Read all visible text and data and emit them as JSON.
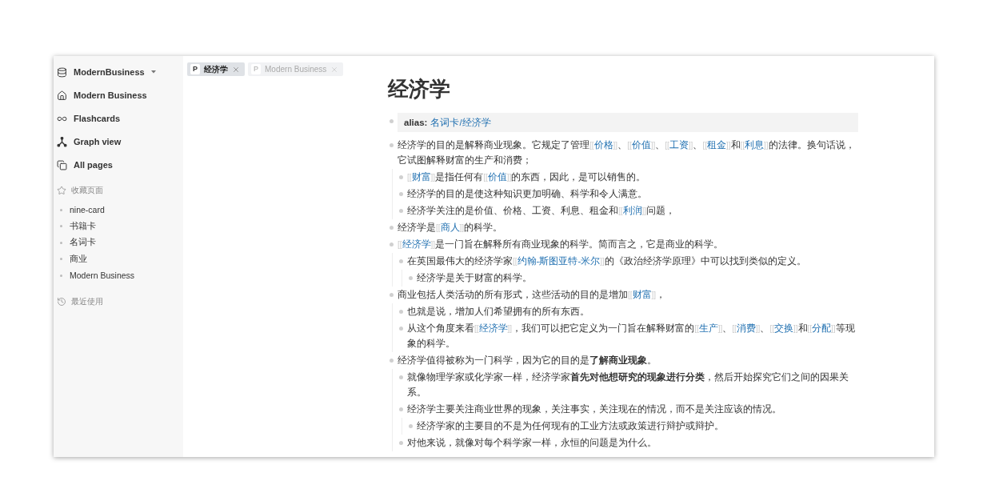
{
  "sidebar": {
    "workspace": "ModernBusiness",
    "nav": [
      {
        "kind": "home",
        "label": "Modern Business"
      },
      {
        "kind": "flashcards",
        "label": "Flashcards"
      },
      {
        "kind": "graph",
        "label": "Graph view"
      },
      {
        "kind": "pages",
        "label": "All pages"
      }
    ],
    "favorites": {
      "title": "收藏页面",
      "items": [
        "nine-card",
        "书籍卡",
        "名词卡",
        "商业",
        "Modern Business"
      ]
    },
    "recent": {
      "title": "最近使用"
    }
  },
  "tabs": [
    {
      "badge": "P",
      "label": "经济学",
      "selected": true
    },
    {
      "badge": "P",
      "label": "Modern Business",
      "selected": false
    }
  ],
  "page": {
    "title": "经济学",
    "blocks": [
      {
        "kind": "property",
        "label": "alias:",
        "value": "名词卡/经济学"
      },
      {
        "kind": "text",
        "segments": [
          {
            "kind": "text",
            "text": "经济学的目的是解释商业现象。它规定了管理"
          },
          {
            "kind": "link",
            "open": "[[",
            "text": "价格",
            "close": "]]"
          },
          {
            "kind": "text",
            "text": "、"
          },
          {
            "kind": "link",
            "open": "[[",
            "text": "价值",
            "close": "]]"
          },
          {
            "kind": "text",
            "text": "、"
          },
          {
            "kind": "link",
            "open": "[[",
            "text": "工资",
            "close": "]]"
          },
          {
            "kind": "text",
            "text": "、"
          },
          {
            "kind": "link",
            "open": "[[",
            "text": "租金",
            "close": "]]"
          },
          {
            "kind": "text",
            "text": "和"
          },
          {
            "kind": "link",
            "open": "[[",
            "text": "利息",
            "close": "]]"
          },
          {
            "kind": "text",
            "text": "的法律。换句话说，它试图解释财富的生产和消费；"
          }
        ],
        "children": [
          {
            "kind": "text",
            "segments": [
              {
                "kind": "link",
                "open": "[[",
                "text": "财富",
                "close": "]]"
              },
              {
                "kind": "text",
                "text": "是指任何有"
              },
              {
                "kind": "link",
                "open": "[[",
                "text": "价值",
                "close": "]]"
              },
              {
                "kind": "text",
                "text": "的东西，因此，是可以销售的。"
              }
            ]
          },
          {
            "kind": "text",
            "segments": [
              {
                "kind": "text",
                "text": "经济学的目的是使这种知识更加明确、科学和令人满意。"
              }
            ]
          },
          {
            "kind": "text",
            "segments": [
              {
                "kind": "text",
                "text": "经济学关注的是价值、价格、工资、利息、租金和"
              },
              {
                "kind": "link",
                "open": "[[",
                "text": "利润",
                "close": "]]"
              },
              {
                "kind": "text",
                "text": "问题，"
              }
            ]
          }
        ]
      },
      {
        "kind": "text",
        "segments": [
          {
            "kind": "text",
            "text": "经济学是"
          },
          {
            "kind": "link",
            "open": "[[",
            "text": "商人",
            "close": "]]"
          },
          {
            "kind": "text",
            "text": "的科学。"
          }
        ]
      },
      {
        "kind": "text",
        "segments": [
          {
            "kind": "link",
            "open": "[[",
            "text": "经济学",
            "close": "]]"
          },
          {
            "kind": "text",
            "text": "是一门旨在解释所有商业现象的科学。简而言之，它是商业的科学。"
          }
        ],
        "children": [
          {
            "kind": "text",
            "segments": [
              {
                "kind": "text",
                "text": "在英国最伟大的经济学家"
              },
              {
                "kind": "link",
                "open": "[[",
                "text": "约翰-斯图亚特-米尔",
                "close": "]]"
              },
              {
                "kind": "text",
                "text": "的《政治经济学原理》中可以找到类似的定义。"
              }
            ],
            "children": [
              {
                "kind": "text",
                "segments": [
                  {
                    "kind": "text",
                    "text": "经济学是关于财富的科学。"
                  }
                ]
              }
            ]
          }
        ]
      },
      {
        "kind": "text",
        "segments": [
          {
            "kind": "text",
            "text": "商业包括人类活动的所有形式，这些活动的目的是增加"
          },
          {
            "kind": "link",
            "open": "[[",
            "text": "财富",
            "close": "]]"
          },
          {
            "kind": "text",
            "text": "，"
          }
        ],
        "children": [
          {
            "kind": "text",
            "segments": [
              {
                "kind": "text",
                "text": "也就是说，增加人们希望拥有的所有东西。"
              }
            ]
          },
          {
            "kind": "text",
            "segments": [
              {
                "kind": "text",
                "text": "从这个角度来看"
              },
              {
                "kind": "link",
                "open": "[[",
                "text": "经济学",
                "close": "]]"
              },
              {
                "kind": "text",
                "text": "，我们可以把它定义为一门旨在解释财富的"
              },
              {
                "kind": "link",
                "open": "[[",
                "text": "生产",
                "close": "]]"
              },
              {
                "kind": "text",
                "text": "、"
              },
              {
                "kind": "link",
                "open": "[[",
                "text": "消费",
                "close": "]]"
              },
              {
                "kind": "text",
                "text": "、"
              },
              {
                "kind": "link",
                "open": "[[",
                "text": "交换",
                "close": "]]"
              },
              {
                "kind": "text",
                "text": "和"
              },
              {
                "kind": "link",
                "open": "[[",
                "text": "分配",
                "close": "]]"
              },
              {
                "kind": "text",
                "text": "等现象的科学。"
              }
            ]
          }
        ]
      },
      {
        "kind": "text",
        "segments": [
          {
            "kind": "text",
            "text": "经济学值得被称为一门科学，因为它的目的是"
          },
          {
            "kind": "bold",
            "text": "了解商业现象"
          },
          {
            "kind": "text",
            "text": "。"
          }
        ],
        "children": [
          {
            "kind": "text",
            "segments": [
              {
                "kind": "text",
                "text": "就像物理学家或化学家一样，经济学家"
              },
              {
                "kind": "bold",
                "text": "首先对他想研究的现象进行分类"
              },
              {
                "kind": "text",
                "text": "，然后开始探究它们之间的因果关系。"
              }
            ]
          },
          {
            "kind": "text",
            "segments": [
              {
                "kind": "text",
                "text": "经济学主要关注商业世界的现象，关注事实，关注现在的情况，而不是关注应该的情况。"
              }
            ],
            "children": [
              {
                "kind": "text",
                "segments": [
                  {
                    "kind": "text",
                    "text": "经济学家的主要目的不是为任何现有的工业方法或政策进行辩护或辩护。"
                  }
                ]
              }
            ]
          },
          {
            "kind": "text",
            "segments": [
              {
                "kind": "text",
                "text": "对他来说，就像对每个科学家一样，永恒的问题是为什么。"
              }
            ]
          }
        ]
      }
    ]
  }
}
